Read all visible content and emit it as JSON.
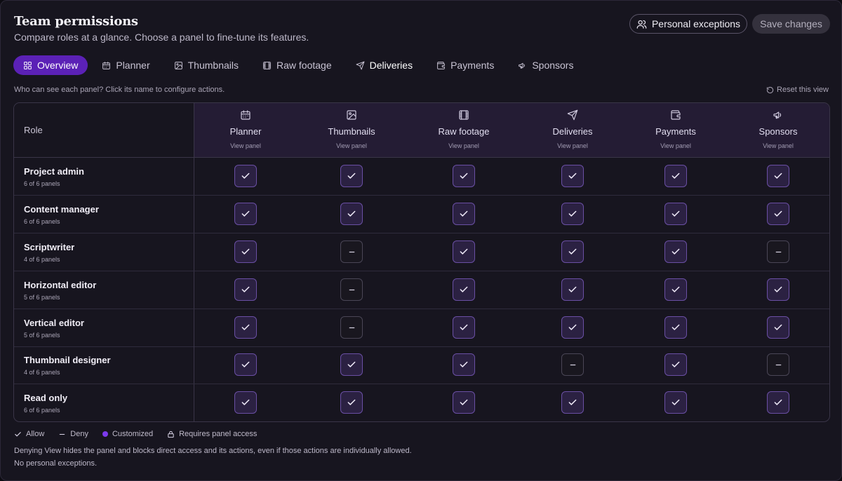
{
  "header": {
    "title": "Team permissions",
    "subtitle": "Compare roles at a glance. Choose a panel to fine-tune its features.",
    "exceptions_label": "Personal exceptions",
    "save_label": "Save changes"
  },
  "tabs": [
    {
      "label": "Overview",
      "icon": "grid-icon",
      "active": true
    },
    {
      "label": "Planner",
      "icon": "calendar-icon"
    },
    {
      "label": "Thumbnails",
      "icon": "image-icon"
    },
    {
      "label": "Raw footage",
      "icon": "film-icon"
    },
    {
      "label": "Deliveries",
      "icon": "send-icon"
    },
    {
      "label": "Payments",
      "icon": "wallet-icon"
    },
    {
      "label": "Sponsors",
      "icon": "megaphone-icon"
    }
  ],
  "hint": "Who can see each panel? Click its name to configure actions.",
  "reset_label": "Reset this view",
  "table": {
    "role_header": "Role",
    "columns": [
      {
        "name": "Planner",
        "sub": "View panel",
        "icon": "calendar-icon"
      },
      {
        "name": "Thumbnails",
        "sub": "View panel",
        "icon": "image-icon"
      },
      {
        "name": "Raw footage",
        "sub": "View panel",
        "icon": "film-icon"
      },
      {
        "name": "Deliveries",
        "sub": "View panel",
        "icon": "send-icon"
      },
      {
        "name": "Payments",
        "sub": "View panel",
        "icon": "wallet-icon"
      },
      {
        "name": "Sponsors",
        "sub": "View panel",
        "icon": "megaphone-icon"
      }
    ],
    "rows": [
      {
        "name": "Project admin",
        "count": "6 of 6 panels",
        "cells": [
          "allow",
          "allow",
          "allow",
          "allow",
          "allow",
          "allow"
        ]
      },
      {
        "name": "Content manager",
        "count": "6 of 6 panels",
        "cells": [
          "allow",
          "allow",
          "allow",
          "allow",
          "allow",
          "allow"
        ]
      },
      {
        "name": "Scriptwriter",
        "count": "4 of 6 panels",
        "cells": [
          "allow",
          "deny",
          "allow",
          "allow",
          "allow",
          "deny"
        ]
      },
      {
        "name": "Horizontal editor",
        "count": "5 of 6 panels",
        "cells": [
          "allow",
          "deny",
          "allow",
          "allow",
          "allow",
          "allow"
        ]
      },
      {
        "name": "Vertical editor",
        "count": "5 of 6 panels",
        "cells": [
          "allow",
          "deny",
          "allow",
          "allow",
          "allow",
          "allow"
        ]
      },
      {
        "name": "Thumbnail designer",
        "count": "4 of 6 panels",
        "cells": [
          "allow",
          "allow",
          "allow",
          "deny",
          "allow",
          "deny"
        ]
      },
      {
        "name": "Read only",
        "count": "6 of 6 panels",
        "cells": [
          "allow",
          "allow",
          "allow",
          "allow",
          "allow",
          "allow"
        ]
      }
    ]
  },
  "legend": {
    "allow": "Allow",
    "deny": "Deny",
    "customized": "Customized",
    "requires": "Requires panel access"
  },
  "notes": {
    "line1": "Denying View hides the panel and blocks direct access and its actions, even if those actions are individually allowed.",
    "line2": "No personal exceptions."
  },
  "colors": {
    "accent": "#5b21b6",
    "customized_dot": "#7c3aed",
    "allow_border": "#6a4fa4",
    "header_bg": "#241c34"
  }
}
